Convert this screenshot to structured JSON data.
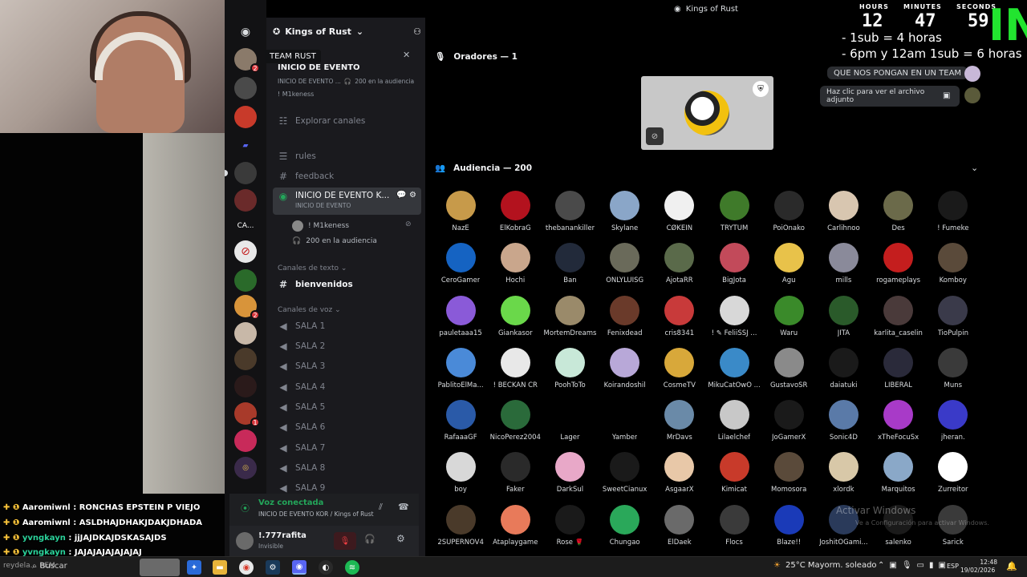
{
  "window": {
    "title": "Kings of Rust"
  },
  "overlay": {
    "timer_labels": [
      "HOURS",
      "MINUTES",
      "SECONDS"
    ],
    "timer_values": [
      "12",
      "47",
      "59"
    ],
    "sub_line1": "- 1sub = 4 horas",
    "sub_line2": "- 6pm y 12am 1sub = 6 horas",
    "big_text": "IN",
    "chat_msg1": "QUE NOS PONGAN EN UN TEAM",
    "chat_msg2": "Haz clic para ver el archivo adjunto"
  },
  "sidebar": {
    "server_name": "Kings of Rust",
    "tooltip": "TEAM RUST",
    "event": {
      "title": "INICIO DE EVENTO",
      "sub": "INICIO DE EVENTO ...",
      "audience": "200 en la audiencia",
      "host": "! M1keness"
    },
    "explore": "Explorar canales",
    "channels": [
      {
        "icon": "rules-icon",
        "glyph": "☰",
        "label": "rules"
      },
      {
        "icon": "hash-icon",
        "glyph": "#",
        "label": "feedback"
      }
    ],
    "stage": {
      "label": "INICIO DE EVENTO K...",
      "topic": "INICIO DE EVENTO",
      "speaker": "! M1keness",
      "audience": "200 en la audiencia"
    },
    "cat_text": "Canales de texto",
    "text_channel": "bienvenidos",
    "cat_voice": "Canales de voz",
    "voice_channels": [
      "SALA 1",
      "SALA 2",
      "SALA 3",
      "SALA 4",
      "SALA 5",
      "SALA 6",
      "SALA 7",
      "SALA 8",
      "SALA 9"
    ],
    "voice_status": "Voz conectada",
    "voice_where": "INICIO DE EVENTO KOR / Kings of Rust",
    "user_name": "!.777rafita",
    "user_status": "Invisible"
  },
  "rail": {
    "ca_label": "CA...",
    "badges": [
      "2",
      "2",
      "1"
    ]
  },
  "stage": {
    "speakers_header": "Oradores — 1",
    "audience_header": "Audiencia — 200",
    "audience": [
      {
        "name": "NazE",
        "color": "#c79a4a"
      },
      {
        "name": "ElKobraG",
        "color": "#b3121e"
      },
      {
        "name": "thebanankiller",
        "color": "#4a4a4a"
      },
      {
        "name": "Skylane",
        "color": "#8aa6c8"
      },
      {
        "name": "CØKEIN",
        "color": "#f0f0f0"
      },
      {
        "name": "TRYTUM",
        "color": "#3f7a2a"
      },
      {
        "name": "PoiOnako",
        "color": "#2a2a2a"
      },
      {
        "name": "Carlihnoo",
        "color": "#d8c6b0"
      },
      {
        "name": "Des",
        "color": "#6b6a4a"
      },
      {
        "name": "! Fumeke",
        "color": "#1a1a1a"
      },
      {
        "name": "CeroGamer",
        "color": "#1563c2"
      },
      {
        "name": "Hochi",
        "color": "#c9a68c"
      },
      {
        "name": "Ban",
        "color": "#222a3a"
      },
      {
        "name": "ONLYLUISG",
        "color": "#6a6a5a"
      },
      {
        "name": "AjotaRR",
        "color": "#5a6a4a"
      },
      {
        "name": "BigJota",
        "color": "#c24a5a"
      },
      {
        "name": "Agu",
        "color": "#e8c24a"
      },
      {
        "name": "mills",
        "color": "#8a8a9a"
      },
      {
        "name": "rogameplays",
        "color": "#c41e1e"
      },
      {
        "name": "Komboy",
        "color": "#5a4a3a"
      },
      {
        "name": "pauletaaa15",
        "color": "#8a5ad8"
      },
      {
        "name": "Giankasor",
        "color": "#6ad84a"
      },
      {
        "name": "MortemDreams",
        "color": "#9a8a6a"
      },
      {
        "name": "Fenixdead",
        "color": "#6a3a2a"
      },
      {
        "name": "cris8341",
        "color": "#c83a3a"
      },
      {
        "name": "! ✎ FeliiSSJ ...",
        "color": "#d8d8d8"
      },
      {
        "name": "Waru",
        "color": "#3a8a2a"
      },
      {
        "name": "JITA",
        "color": "#2a5a2a"
      },
      {
        "name": "karlita_caselin",
        "color": "#4a3a3a"
      },
      {
        "name": "TioPulpin",
        "color": "#3a3a4a"
      },
      {
        "name": "PablitoElMa...",
        "color": "#4a8ad8"
      },
      {
        "name": "! BECKAN CR",
        "color": "#e8e8e8"
      },
      {
        "name": "PoohToTo",
        "color": "#c8e8d8"
      },
      {
        "name": "Koirandoshil",
        "color": "#b8a8d8"
      },
      {
        "name": "CosmeTV",
        "color": "#d8a83a"
      },
      {
        "name": "MikuCatOwO ...",
        "color": "#3a8ac8"
      },
      {
        "name": "GustavoSR",
        "color": "#8a8a8a"
      },
      {
        "name": "daiatuki",
        "color": "#1a1a1a"
      },
      {
        "name": "LIBERAL",
        "color": "#2a2a3a"
      },
      {
        "name": "Muns",
        "color": "#3a3a3a"
      },
      {
        "name": "RafaaaGF",
        "color": "#2a5aa8"
      },
      {
        "name": "NicoPerez2004",
        "color": "#2a6a3a"
      },
      {
        "name": "Lager",
        "color": "#000000"
      },
      {
        "name": "Yamber",
        "color": "#000000"
      },
      {
        "name": "MrDavs",
        "color": "#6a8aa8"
      },
      {
        "name": "Lilaelchef",
        "color": "#c8c8c8"
      },
      {
        "name": "JoGamerX",
        "color": "#1a1a1a"
      },
      {
        "name": "Sonic4D",
        "color": "#5a7aa8"
      },
      {
        "name": "xTheFocuSx",
        "color": "#a83ac8"
      },
      {
        "name": "jheran.",
        "color": "#3a3ac8"
      },
      {
        "name": "boy",
        "color": "#d8d8d8"
      },
      {
        "name": "Faker",
        "color": "#2a2a2a"
      },
      {
        "name": "DarkSul",
        "color": "#e8a8c8"
      },
      {
        "name": "SweetCianux",
        "color": "#1a1a1a"
      },
      {
        "name": "AsgaarX",
        "color": "#e8c8a8"
      },
      {
        "name": "Kimicat",
        "color": "#c83a2a"
      },
      {
        "name": "Momosora",
        "color": "#5a4a3a"
      },
      {
        "name": "xlordk",
        "color": "#d8c8a8"
      },
      {
        "name": "Marquitos",
        "color": "#8aa8c8"
      },
      {
        "name": "Zurreitor",
        "color": "#ffffff"
      },
      {
        "name": "2SUPERNOV4",
        "color": "#4a3a2a"
      },
      {
        "name": "Ataplaygame",
        "color": "#e87a5a"
      },
      {
        "name": "Rose 🌹",
        "color": "#1a1a1a"
      },
      {
        "name": "Chungao",
        "color": "#2aa85a"
      },
      {
        "name": "ElDaek",
        "color": "#6a6a6a"
      },
      {
        "name": "Flocs",
        "color": "#3a3a3a"
      },
      {
        "name": "Blaze!!",
        "color": "#1a3ab8"
      },
      {
        "name": "JoshitOGami...",
        "color": "#2a3a5a"
      },
      {
        "name": "salenko",
        "color": "#1a1a1a"
      },
      {
        "name": "Sarick",
        "color": "#3a3a3a"
      }
    ]
  },
  "twitch_chat": [
    {
      "user": "Aaromiwnl",
      "msg": "RONCHAS EPSTEIN P VIEJO"
    },
    {
      "user": "Aaromiwnl",
      "msg": "ASLDHAJDHAKJDAKJDHADA"
    },
    {
      "user": "yvngkayn",
      "msg": "jjJAJDKAJDSKASAJDS"
    },
    {
      "user": "yvngkayn",
      "msg": "JAJAJAJAJAJAJAJ"
    }
  ],
  "taskbar": {
    "search": "Buscar",
    "weather": "25°C  Mayorm. soleado",
    "lang": "ESP",
    "time": "12:48",
    "date": "19/02/2026",
    "bottom_left": "reydela... REM"
  },
  "watermark": {
    "line1": "Activar Windows",
    "line2": "Ve a Configuración para activar Windows."
  }
}
